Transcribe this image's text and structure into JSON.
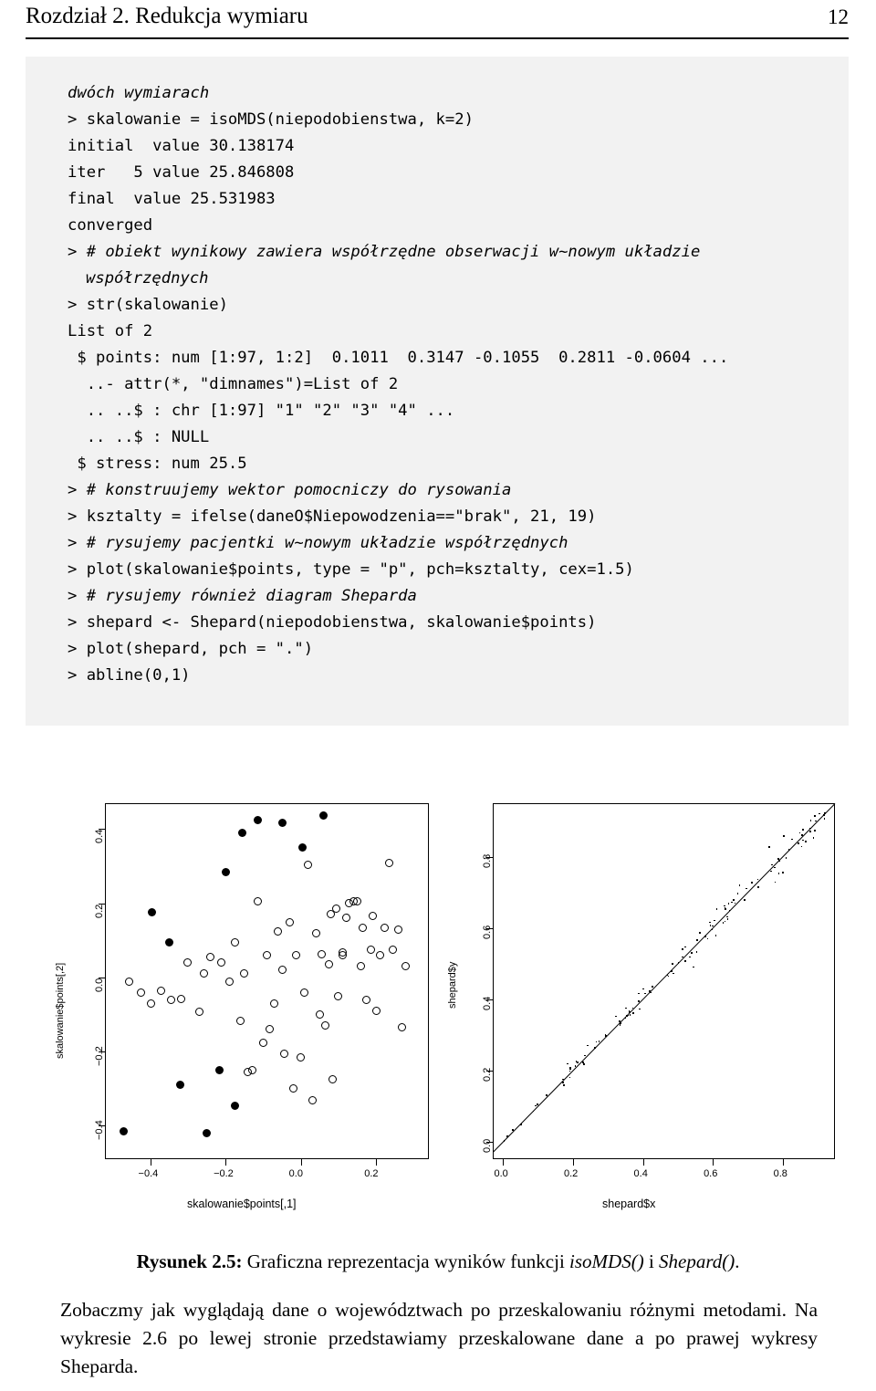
{
  "header": {
    "chapter": "Rozdział 2. Redukcja wymiaru",
    "page_number": "12"
  },
  "code": {
    "lines": [
      {
        "text": "dwóch wymiarach",
        "style": "comment",
        "indent": 0
      },
      {
        "text": "> skalowanie = isoMDS(niepodobienstwa, k=2)",
        "style": "plain",
        "indent": 0
      },
      {
        "text": "initial  value 30.138174",
        "style": "plain",
        "indent": 0
      },
      {
        "text": "iter   5 value 25.846808",
        "style": "plain",
        "indent": 0
      },
      {
        "text": "final  value 25.531983",
        "style": "plain",
        "indent": 0
      },
      {
        "text": "converged",
        "style": "plain",
        "indent": 0
      },
      {
        "text": "> # obiekt wynikowy zawiera współrzędne obserwacji w~nowym układzie",
        "style": "comment",
        "indent": 0
      },
      {
        "text": "współrzędnych",
        "style": "comment",
        "indent": 1
      },
      {
        "text": "> str(skalowanie)",
        "style": "plain",
        "indent": 0
      },
      {
        "text": "List of 2",
        "style": "plain",
        "indent": 0
      },
      {
        "text": " $ points: num [1:97, 1:2]  0.1011  0.3147 -0.1055  0.2811 -0.0604 ...",
        "style": "plain",
        "indent": 0
      },
      {
        "text": "  ..- attr(*, \"dimnames\")=List of 2",
        "style": "plain",
        "indent": 0
      },
      {
        "text": "  .. ..$ : chr [1:97] \"1\" \"2\" \"3\" \"4\" ...",
        "style": "plain",
        "indent": 0
      },
      {
        "text": "  .. ..$ : NULL",
        "style": "plain",
        "indent": 0
      },
      {
        "text": " $ stress: num 25.5",
        "style": "plain",
        "indent": 0
      },
      {
        "text": "> # konstruujemy wektor pomocniczy do rysowania",
        "style": "comment",
        "indent": 0
      },
      {
        "text": "> ksztalty = ifelse(daneO$Niepowodzenia==\"brak\", 21, 19)",
        "style": "plain",
        "indent": 0
      },
      {
        "text": "> # rysujemy pacjentki w~nowym układzie współrzędnych",
        "style": "comment",
        "indent": 0
      },
      {
        "text": "> plot(skalowanie$points, type = \"p\", pch=ksztalty, cex=1.5)",
        "style": "plain",
        "indent": 0
      },
      {
        "text": "> # rysujemy również diagram Sheparda",
        "style": "comment",
        "indent": 0
      },
      {
        "text": "> shepard <- Shepard(niepodobienstwa, skalowanie$points)",
        "style": "plain",
        "indent": 0
      },
      {
        "text": "> plot(shepard, pch = \".\")",
        "style": "plain",
        "indent": 0
      },
      {
        "text": "> abline(0,1)",
        "style": "plain",
        "indent": 0
      }
    ]
  },
  "figure_caption": {
    "label": "Rysunek 2.5:",
    "text_before": " Graficzna reprezentacja wyników funkcji ",
    "italic1": "isoMDS()",
    "text_middle": " i ",
    "italic2": "Shepard()",
    "text_after": "."
  },
  "paragraph": "Zobaczmy jak wyglądają dane o województwach po przeskalowaniu różnymi metodami. Na wykresie 2.6 po lewej stronie przedstawiamy przeskalowane dane a po prawej wykresy Sheparda.",
  "chart_data": [
    {
      "type": "scatter",
      "title": "",
      "xlabel": "skalowanie$points[,1]",
      "ylabel": "skalowanie$points[,2]",
      "xticks": [
        "−0.4",
        "−0.2",
        "0.0",
        "0.2"
      ],
      "xtick_values": [
        -0.4,
        -0.2,
        0.0,
        0.2
      ],
      "yticks": [
        "−0.4",
        "−0.2",
        "0.0",
        "0.2",
        "0.4"
      ],
      "ytick_values": [
        -0.4,
        -0.2,
        0.0,
        0.2,
        0.4
      ],
      "xlim": [
        -0.52,
        0.34
      ],
      "ylim": [
        -0.49,
        0.47
      ],
      "grid": false,
      "legend": "none",
      "marker_note": "open circles = pch 21 (brak niepowodzen), filled circles = pch 19",
      "points_open": [
        [
          -0.455,
          -0.012
        ],
        [
          -0.425,
          -0.04
        ],
        [
          -0.398,
          -0.07
        ],
        [
          -0.372,
          -0.035
        ],
        [
          -0.345,
          -0.06
        ],
        [
          -0.318,
          -0.058
        ],
        [
          -0.3,
          0.04
        ],
        [
          -0.27,
          -0.092
        ],
        [
          -0.258,
          0.012
        ],
        [
          -0.24,
          0.055
        ],
        [
          -0.21,
          0.04
        ],
        [
          -0.19,
          -0.01
        ],
        [
          -0.175,
          0.095
        ],
        [
          -0.16,
          -0.118
        ],
        [
          -0.15,
          0.012
        ],
        [
          -0.14,
          -0.255
        ],
        [
          -0.128,
          -0.25
        ],
        [
          -0.115,
          0.205
        ],
        [
          -0.1,
          -0.175
        ],
        [
          -0.09,
          0.06
        ],
        [
          -0.082,
          -0.14
        ],
        [
          -0.07,
          -0.07
        ],
        [
          -0.06,
          0.125
        ],
        [
          -0.05,
          0.02
        ],
        [
          -0.045,
          -0.205
        ],
        [
          -0.03,
          0.15
        ],
        [
          -0.02,
          -0.3
        ],
        [
          -0.012,
          0.06
        ],
        [
          0.0,
          -0.215
        ],
        [
          0.01,
          -0.04
        ],
        [
          0.02,
          0.305
        ],
        [
          0.03,
          -0.33
        ],
        [
          0.04,
          0.12
        ],
        [
          0.05,
          -0.1
        ],
        [
          0.055,
          0.062
        ],
        [
          0.065,
          -0.13
        ],
        [
          0.075,
          0.035
        ],
        [
          0.08,
          0.17
        ],
        [
          0.085,
          -0.275
        ],
        [
          0.095,
          0.185
        ],
        [
          0.1,
          -0.05
        ],
        [
          0.11,
          0.068
        ],
        [
          0.112,
          0.06
        ],
        [
          0.12,
          0.16
        ],
        [
          0.128,
          0.2
        ],
        [
          0.14,
          0.205
        ],
        [
          0.15,
          0.205
        ],
        [
          0.16,
          0.03
        ],
        [
          0.165,
          0.135
        ],
        [
          0.175,
          -0.06
        ],
        [
          0.185,
          0.075
        ],
        [
          0.19,
          0.165
        ],
        [
          0.2,
          -0.09
        ],
        [
          0.21,
          0.06
        ],
        [
          0.222,
          0.135
        ],
        [
          0.235,
          0.31
        ],
        [
          0.245,
          0.075
        ],
        [
          0.258,
          0.13
        ],
        [
          0.268,
          -0.135
        ],
        [
          0.278,
          0.03
        ]
      ],
      "points_filled": [
        [
          -0.47,
          -0.415
        ],
        [
          -0.395,
          0.175
        ],
        [
          -0.35,
          0.095
        ],
        [
          -0.32,
          -0.29
        ],
        [
          -0.25,
          -0.42
        ],
        [
          -0.215,
          -0.25
        ],
        [
          -0.2,
          0.285
        ],
        [
          -0.175,
          -0.345
        ],
        [
          -0.155,
          0.39
        ],
        [
          -0.115,
          0.425
        ],
        [
          -0.05,
          0.418
        ],
        [
          0.005,
          0.35
        ],
        [
          0.06,
          0.438
        ]
      ]
    },
    {
      "type": "scatter",
      "title": "",
      "xlabel": "shepard$x",
      "ylabel": "shepard$y",
      "xticks": [
        "0.0",
        "0.2",
        "0.4",
        "0.6",
        "0.8"
      ],
      "xtick_values": [
        0.0,
        0.2,
        0.4,
        0.6,
        0.8
      ],
      "yticks": [
        "0.0",
        "0.2",
        "0.4",
        "0.6",
        "0.8"
      ],
      "ytick_values": [
        0.0,
        0.2,
        0.4,
        0.6,
        0.8
      ],
      "xlim": [
        -0.03,
        0.95
      ],
      "ylim": [
        -0.05,
        0.95
      ],
      "grid": false,
      "legend": "none",
      "annotation": "abline(0,1) identity reference line",
      "n_points": 4656,
      "marker_note": "pch='.' tiny dots, dense cloud along identity line"
    }
  ]
}
